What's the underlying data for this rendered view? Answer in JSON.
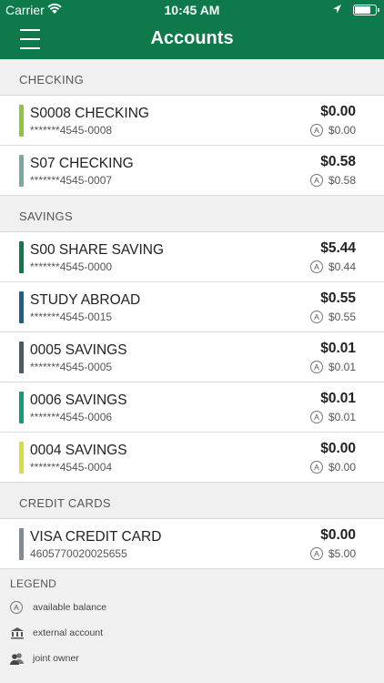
{
  "status_bar": {
    "carrier": "Carrier",
    "time": "10:45 AM",
    "battery_level": 0.8
  },
  "header": {
    "title": "Accounts",
    "menu_icon": "hamburger-menu-icon"
  },
  "colors": {
    "brand": "#0e7a4b"
  },
  "sections": [
    {
      "title": "CHECKING",
      "accounts": [
        {
          "name": "S0008 CHECKING",
          "number": "*******4545-0008",
          "balance": "$0.00",
          "available": "$0.00",
          "color": "#8dc63f"
        },
        {
          "name": "S07 CHECKING",
          "number": "*******4545-0007",
          "balance": "$0.58",
          "available": "$0.58",
          "color": "#7aa9a0"
        }
      ]
    },
    {
      "title": "SAVINGS",
      "accounts": [
        {
          "name": "S00 SHARE SAVING",
          "number": "*******4545-0000",
          "balance": "$5.44",
          "available": "$0.44",
          "color": "#0e7a4b"
        },
        {
          "name": "STUDY ABROAD",
          "number": "*******4545-0015",
          "balance": "$0.55",
          "available": "$0.55",
          "color": "#1f5f82"
        },
        {
          "name": "0005 SAVINGS",
          "number": "*******4545-0005",
          "balance": "$0.01",
          "available": "$0.01",
          "color": "#4a5a63"
        },
        {
          "name": "0006 SAVINGS",
          "number": "*******4545-0006",
          "balance": "$0.01",
          "available": "$0.01",
          "color": "#149c7a"
        },
        {
          "name": "0004 SAVINGS",
          "number": "*******4545-0004",
          "balance": "$0.00",
          "available": "$0.00",
          "color": "#d7df3a"
        }
      ]
    },
    {
      "title": "CREDIT CARDS",
      "accounts": [
        {
          "name": "VISA CREDIT CARD",
          "number": "4605770020025655",
          "balance": "$0.00",
          "available": "$5.00",
          "color": "#7f8c93"
        }
      ]
    }
  ],
  "legend": {
    "title": "LEGEND",
    "available_symbol": "A",
    "items": [
      {
        "icon": "available-balance-icon",
        "label": "available balance"
      },
      {
        "icon": "bank-building-icon",
        "label": "external account"
      },
      {
        "icon": "joint-owner-icon",
        "label": "joint owner"
      }
    ]
  }
}
